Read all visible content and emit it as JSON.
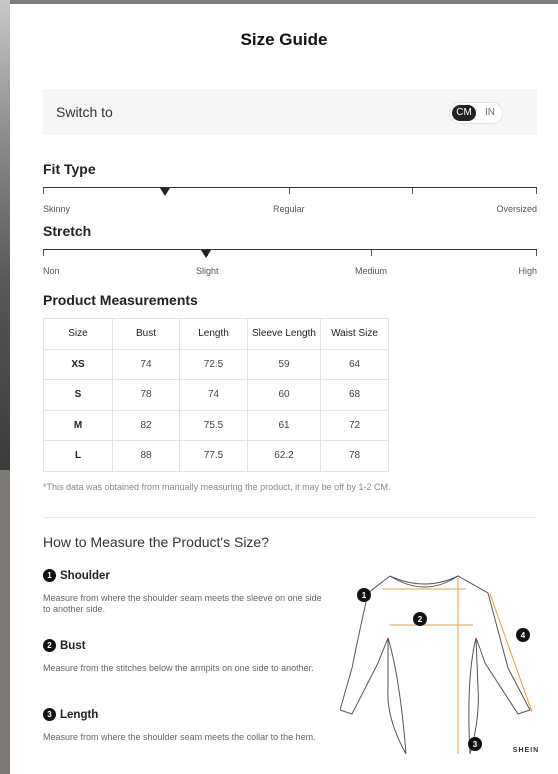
{
  "title": "Size Guide",
  "switch": {
    "label": "Switch to",
    "cm": "CM",
    "in": "IN",
    "selected": "CM"
  },
  "fit_type": {
    "heading": "Fit Type",
    "labels": [
      "Skinny",
      "Regular",
      "Oversized"
    ],
    "selected_position": 0.25
  },
  "stretch": {
    "heading": "Stretch",
    "labels": [
      "Non",
      "Slight",
      "Medium",
      "High"
    ],
    "selected_position": 0.33
  },
  "measurements": {
    "heading": "Product Measurements",
    "columns": [
      "Size",
      "Bust",
      "Length",
      "Sleeve Length",
      "Waist Size"
    ],
    "rows": [
      [
        "XS",
        "74",
        "72.5",
        "59",
        "64"
      ],
      [
        "S",
        "78",
        "74",
        "60",
        "68"
      ],
      [
        "M",
        "82",
        "75.5",
        "61",
        "72"
      ],
      [
        "L",
        "88",
        "77.5",
        "62.2",
        "78"
      ]
    ]
  },
  "note": "*This data was obtained from manually measuring the product, it may be off by 1-2 CM.",
  "how_to": {
    "heading": "How to Measure the Product's Size?",
    "items": [
      {
        "num": "1",
        "title": "Shoulder",
        "desc": "Measure from where the shoulder seam meets the sleeve on one side to another side."
      },
      {
        "num": "2",
        "title": "Bust",
        "desc": "Measure from the stitches below the armpits on one side to another."
      },
      {
        "num": "3",
        "title": "Length",
        "desc": "Measure from where the shoulder seam meets the collar to the hem."
      }
    ]
  },
  "diagram": {
    "markers": [
      "1",
      "2",
      "3",
      "4"
    ],
    "brand": "SHEIN",
    "accent": "#e0a040"
  }
}
